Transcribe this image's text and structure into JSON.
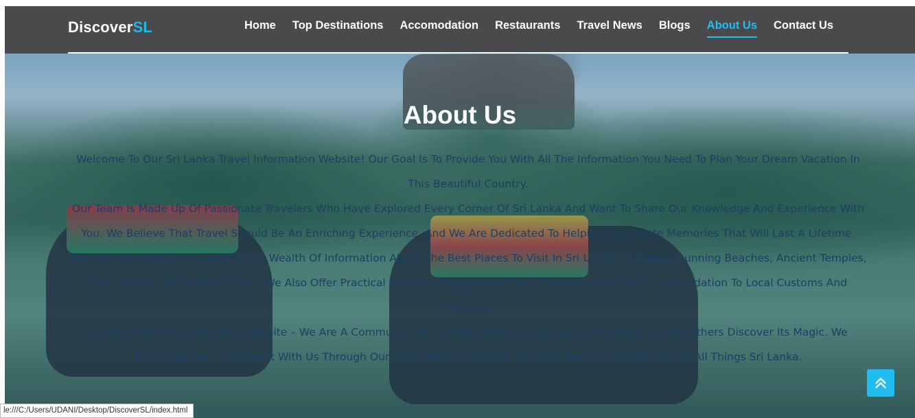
{
  "brand": {
    "name_main": "Discover",
    "name_accent": "SL"
  },
  "nav": {
    "items": [
      {
        "label": "Home",
        "active": false
      },
      {
        "label": "Top Destinations",
        "active": false
      },
      {
        "label": "Accomodation",
        "active": false
      },
      {
        "label": "Restaurants",
        "active": false
      },
      {
        "label": "Travel News",
        "active": false
      },
      {
        "label": "Blogs",
        "active": false
      },
      {
        "label": "About Us",
        "active": true
      },
      {
        "label": "Contact Us",
        "active": false
      }
    ]
  },
  "main": {
    "title": "About Us",
    "paragraphs": [
      "Welcome To Our Sri Lanka Travel Information Website! Our Goal Is To Provide You With All The Information You Need To Plan Your Dream Vacation In This Beautiful Country.",
      "Our Team Is Made Up Of Passionate Travelers Who Have Explored Every Corner Of Sri Lanka And Want To Share Our Knowledge And Experience With You. We Believe That Travel Should Be An Enriching Experience, And We Are Dedicated To Helping You Create Memories That Will Last A Lifetime.",
      "Here On Our Website, You Will Find A Wealth Of Information About The Best Places To Visit In Sri Lanka, Including Stunning Beaches, Ancient Temples, Lush Forests, And Vibrant Cities. We Also Offer Practical Advice On Everything From Transportation And Accommodation To Local Customs And Etiquette.",
      "But We Are More Than Just A Website – We Are A Community Of Travelers Who Love Sri Lanka And Want To Help Others Discover Its Magic. We Encourage You To Connect With Us Through Our Social Media Channels And Join The Conversation About All Things Sri Lanka."
    ]
  },
  "scroll_top": {
    "icon": "double-chevron-up-icon"
  },
  "status_bar": {
    "url": "le:///C:/Users/UDANI/Desktop/DiscoverSL/index.html"
  },
  "colors": {
    "header_bg": "#4a4a4c",
    "accent": "#22bdf0",
    "body_text": "#1d3f62"
  }
}
